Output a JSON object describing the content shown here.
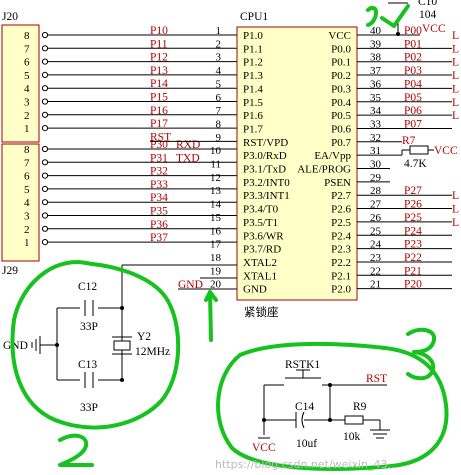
{
  "connectors": {
    "top": {
      "label": "J20",
      "pins": [
        "8",
        "7",
        "6",
        "5",
        "4",
        "3",
        "2",
        "1"
      ]
    },
    "bottom": {
      "label": "J29",
      "pins": [
        "8",
        "7",
        "6",
        "5",
        "4",
        "3",
        "2",
        "1"
      ]
    }
  },
  "left_nets": [
    [
      "P10",
      "P11",
      "P12",
      "P13",
      "P14",
      "P15",
      "P16",
      "P17"
    ],
    [
      "P30",
      "P31",
      "P32",
      "P33",
      "P34",
      "P35",
      "P36",
      "P37"
    ]
  ],
  "left_alt_nets": [
    {
      "row": 0,
      "label": "RXD"
    },
    {
      "row": 1,
      "label": "TXD"
    }
  ],
  "rst_net": "RST",
  "gnd_net": "GND",
  "chip": {
    "designator": "CPU1",
    "name": "紧锁座",
    "left_pins": [
      {
        "num": "1",
        "name": "P1.0"
      },
      {
        "num": "2",
        "name": "P1.1"
      },
      {
        "num": "3",
        "name": "P1.2"
      },
      {
        "num": "4",
        "name": "P1.3"
      },
      {
        "num": "5",
        "name": "P1.4"
      },
      {
        "num": "6",
        "name": "P1.5"
      },
      {
        "num": "7",
        "name": "P1.6"
      },
      {
        "num": "8",
        "name": "P1.7"
      },
      {
        "num": "9",
        "name": "RST/VPD"
      },
      {
        "num": "10",
        "name": "P3.0/RxD"
      },
      {
        "num": "11",
        "name": "P3.1/TxD"
      },
      {
        "num": "12",
        "name": "P3.2/INT0"
      },
      {
        "num": "13",
        "name": "P3.3/INT1"
      },
      {
        "num": "14",
        "name": "P3.4/T0"
      },
      {
        "num": "15",
        "name": "P3.5/T1"
      },
      {
        "num": "16",
        "name": "P3.6/WR"
      },
      {
        "num": "17",
        "name": "P3.7/RD"
      },
      {
        "num": "18",
        "name": "XTAL2"
      },
      {
        "num": "19",
        "name": "XTAL1"
      },
      {
        "num": "20",
        "name": "GND"
      }
    ],
    "right_pins": [
      {
        "num": "40",
        "name": "VCC"
      },
      {
        "num": "39",
        "name": "P0.0"
      },
      {
        "num": "38",
        "name": "P0.1"
      },
      {
        "num": "37",
        "name": "P0.2"
      },
      {
        "num": "36",
        "name": "P0.3"
      },
      {
        "num": "35",
        "name": "P0.4"
      },
      {
        "num": "34",
        "name": "P0.5"
      },
      {
        "num": "33",
        "name": "P0.6"
      },
      {
        "num": "32",
        "name": "P0.7"
      },
      {
        "num": "31",
        "name": "EA/Vpp"
      },
      {
        "num": "30",
        "name": "ALE/PROG"
      },
      {
        "num": "29",
        "name": "PSEN"
      },
      {
        "num": "28",
        "name": "P2.7"
      },
      {
        "num": "27",
        "name": "P2.6"
      },
      {
        "num": "26",
        "name": "P2.5"
      },
      {
        "num": "25",
        "name": "P2.4"
      },
      {
        "num": "24",
        "name": "P2.3"
      },
      {
        "num": "23",
        "name": "P2.2"
      },
      {
        "num": "22",
        "name": "P2.1"
      },
      {
        "num": "21",
        "name": "P2.0"
      }
    ]
  },
  "right_nets": [
    "P00",
    "P01",
    "P02",
    "P03",
    "P04",
    "P05",
    "P06",
    "P07",
    "",
    "",
    "",
    "",
    "P27",
    "P26",
    "P25",
    "P24",
    "P23",
    "P22",
    "P21",
    "P20"
  ],
  "right_edge_labels": [
    "L",
    "L",
    "L",
    "L",
    "L",
    "L",
    "L",
    "",
    "",
    "",
    "",
    "",
    "L",
    "L",
    "L"
  ],
  "vcc": "VCC",
  "c10": {
    "label": "C10",
    "value": "104"
  },
  "r7": {
    "label": "R7",
    "value": "4.7K"
  },
  "osc": {
    "c12": "C12",
    "c12v": "33P",
    "c13": "C13",
    "c13v": "33P",
    "y2": "Y2",
    "y2v": "12MHz",
    "gnd": "GND"
  },
  "reset": {
    "sw": "RSTK1",
    "cap": "C14",
    "capv": "10uf",
    "res": "R9",
    "resv": "10k",
    "vcc": "VCC",
    "rst": "RST"
  },
  "annotations": [
    "1",
    "2",
    "3"
  ],
  "watermark": "https://blog.csdn.net/weixin_43..."
}
